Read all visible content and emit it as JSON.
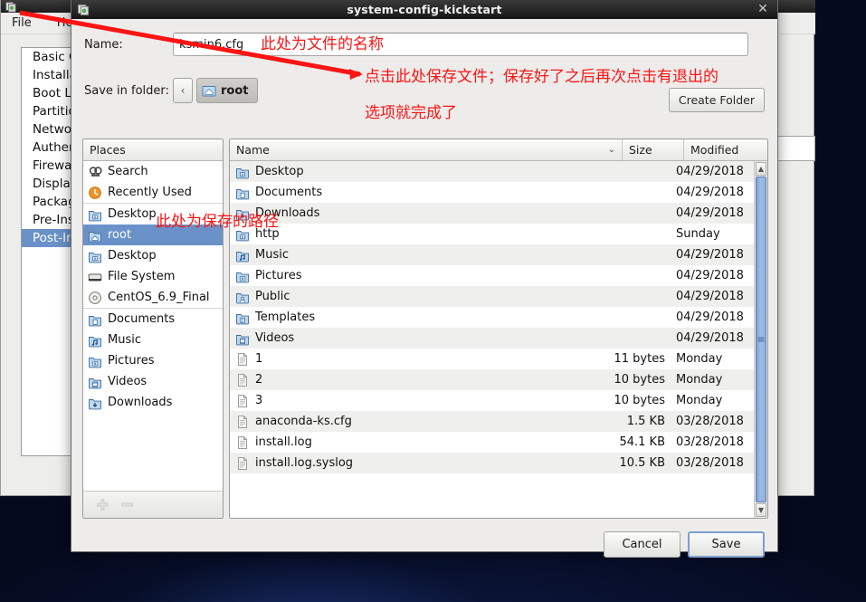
{
  "desktop": {
    "background_color": "#0a1230"
  },
  "background_window": {
    "app_icon": "kickstart-icon",
    "menus": [
      {
        "label": "File"
      },
      {
        "label": "Help"
      }
    ],
    "window_buttons": "–  □  ✕",
    "categories": [
      {
        "label": "Basic Configuration",
        "selected": false
      },
      {
        "label": "Installation Method",
        "selected": false
      },
      {
        "label": "Boot Loader Options",
        "selected": false
      },
      {
        "label": "Partition Information",
        "selected": false
      },
      {
        "label": "Network Configuration",
        "selected": false
      },
      {
        "label": "Authentication",
        "selected": false
      },
      {
        "label": "Firewall Configuration",
        "selected": false
      },
      {
        "label": "Display Configuration",
        "selected": false
      },
      {
        "label": "Package Selection",
        "selected": false
      },
      {
        "label": "Pre-Installation Script",
        "selected": false
      },
      {
        "label": "Post-Installation Script",
        "selected": true
      }
    ]
  },
  "dialog": {
    "title": "system-config-kickstart",
    "icon": "kickstart-icon",
    "close_label": "✕",
    "name_label": "Name:",
    "name_value": "ksmin6.cfg",
    "name_placeholder": "",
    "folder_label": "Save in folder:",
    "path_back_glyph": "‹",
    "path_current": "root",
    "path_icon": "home-folder-icon",
    "create_folder_label": "Create Folder",
    "cancel_label": "Cancel",
    "save_label": "Save",
    "places": {
      "header": "Places",
      "items": [
        {
          "label": "Search",
          "icon": "search-icon",
          "selected": false,
          "separator_before": false
        },
        {
          "label": "Recently Used",
          "icon": "recent-icon",
          "selected": false,
          "separator_before": false
        },
        {
          "label": "Desktop",
          "icon": "folder-icon",
          "selected": false,
          "separator_before": true
        },
        {
          "label": "root",
          "icon": "home-folder-icon",
          "selected": true,
          "separator_before": false
        },
        {
          "label": "Desktop",
          "icon": "folder-icon",
          "selected": false,
          "separator_before": false
        },
        {
          "label": "File System",
          "icon": "drive-icon",
          "selected": false,
          "separator_before": false
        },
        {
          "label": "CentOS_6.9_Final",
          "icon": "cdrom-icon",
          "selected": false,
          "separator_before": false
        },
        {
          "label": "Documents",
          "icon": "folder-documents-icon",
          "selected": false,
          "separator_before": true
        },
        {
          "label": "Music",
          "icon": "folder-music-icon",
          "selected": false,
          "separator_before": false
        },
        {
          "label": "Pictures",
          "icon": "folder-pictures-icon",
          "selected": false,
          "separator_before": false
        },
        {
          "label": "Videos",
          "icon": "folder-videos-icon",
          "selected": false,
          "separator_before": false
        },
        {
          "label": "Downloads",
          "icon": "folder-downloads-icon",
          "selected": false,
          "separator_before": false
        }
      ],
      "add_button": "add-place-button",
      "remove_button": "remove-place-button"
    },
    "file_list": {
      "columns": {
        "name": "Name",
        "size": "Size",
        "modified": "Modified"
      },
      "sort_glyph": "⌄",
      "rows": [
        {
          "name": "Desktop",
          "icon": "folder-icon",
          "size": "",
          "modified": "04/29/2018"
        },
        {
          "name": "Documents",
          "icon": "folder-documents-icon",
          "size": "",
          "modified": "04/29/2018"
        },
        {
          "name": "Downloads",
          "icon": "folder-downloads-icon",
          "size": "",
          "modified": "04/29/2018"
        },
        {
          "name": "http",
          "icon": "folder-icon",
          "size": "",
          "modified": "Sunday"
        },
        {
          "name": "Music",
          "icon": "folder-music-icon",
          "size": "",
          "modified": "04/29/2018"
        },
        {
          "name": "Pictures",
          "icon": "folder-pictures-icon",
          "size": "",
          "modified": "04/29/2018"
        },
        {
          "name": "Public",
          "icon": "folder-public-icon",
          "size": "",
          "modified": "04/29/2018"
        },
        {
          "name": "Templates",
          "icon": "folder-templates-icon",
          "size": "",
          "modified": "04/29/2018"
        },
        {
          "name": "Videos",
          "icon": "folder-videos-icon",
          "size": "",
          "modified": "04/29/2018"
        },
        {
          "name": "1",
          "icon": "file-icon",
          "size": "11 bytes",
          "modified": "Monday"
        },
        {
          "name": "2",
          "icon": "file-icon",
          "size": "10 bytes",
          "modified": "Monday"
        },
        {
          "name": "3",
          "icon": "file-icon",
          "size": "10 bytes",
          "modified": "Monday"
        },
        {
          "name": "anaconda-ks.cfg",
          "icon": "file-icon",
          "size": "1.5 KB",
          "modified": "03/28/2018"
        },
        {
          "name": "install.log",
          "icon": "file-icon",
          "size": "54.1 KB",
          "modified": "03/28/2018"
        },
        {
          "name": "install.log.syslog",
          "icon": "file-icon",
          "size": "10.5 KB",
          "modified": "03/28/2018"
        }
      ],
      "scrollbar": {
        "name": "vertical-scrollbar",
        "up_glyph": "▲",
        "down_glyph": "▼"
      }
    }
  },
  "annotations": {
    "color": "#fb1414",
    "name_note": "此处为文件的名称",
    "save_note_line1": "点击此处保存文件；保存好了之后再次点击有退出的",
    "save_note_line2": "选项就完成了",
    "path_note": "此处为保存的路径"
  }
}
